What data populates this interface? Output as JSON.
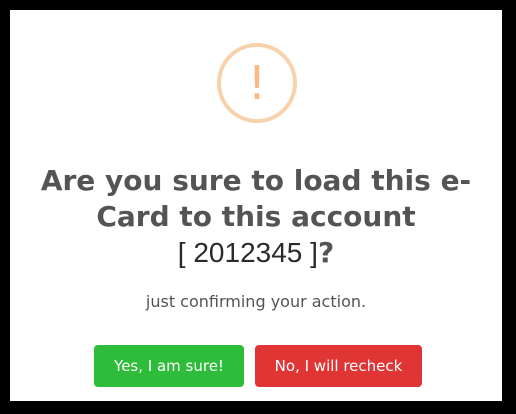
{
  "dialog": {
    "icon": "exclamation-icon",
    "icon_glyph": "!",
    "title_line1": "Are you sure to load this e-",
    "title_line2": "Card to this account",
    "title_open_bracket": "[",
    "account_number": "2012345",
    "title_close_bracket": "]",
    "title_question_mark": "?",
    "message": "just confirming your action.",
    "confirm_label": "Yes, I am sure!",
    "cancel_label": "No, I will recheck"
  },
  "colors": {
    "icon_ring": "#f8d1ad",
    "icon_glyph": "#f8bb86",
    "confirm_button": "#2ebc3b",
    "cancel_button": "#e03535",
    "text": "#545454"
  }
}
